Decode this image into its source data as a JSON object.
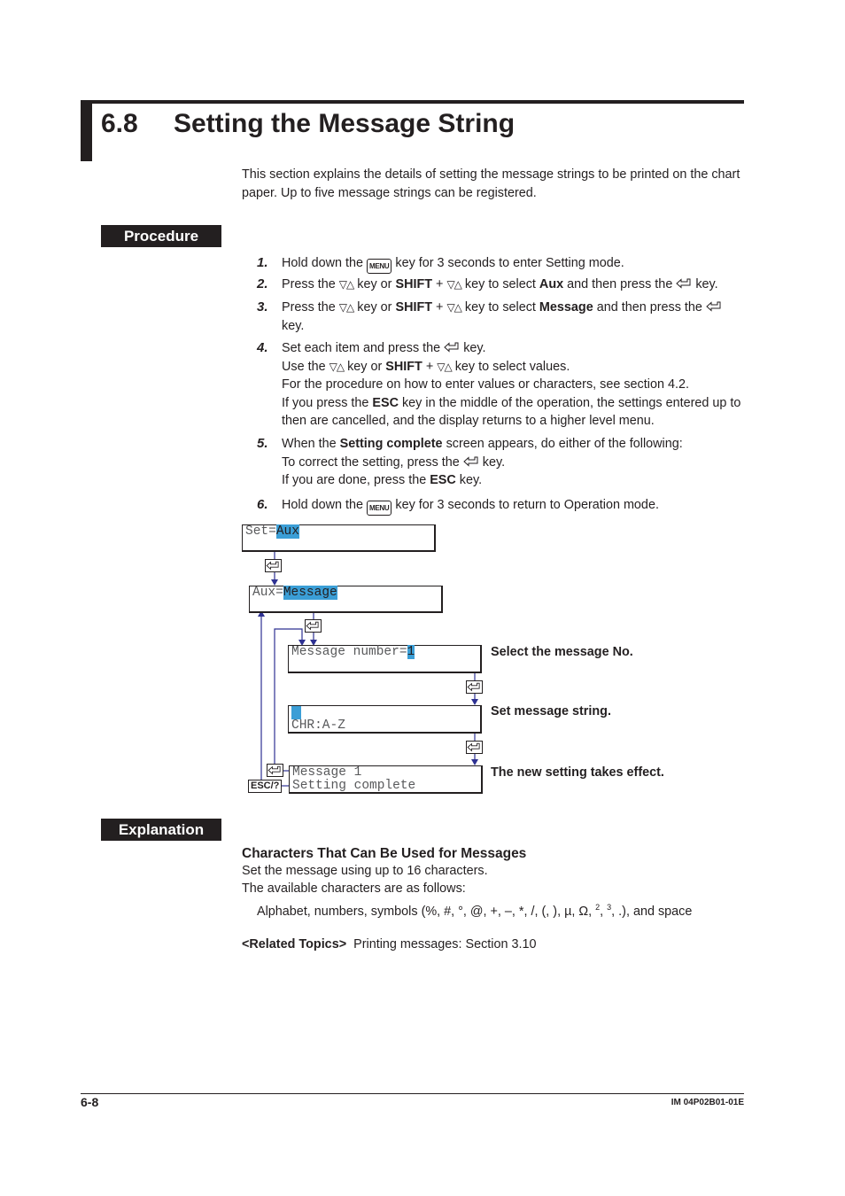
{
  "header": {
    "section_number": "6.8",
    "section_title": "Setting the Message String"
  },
  "intro": "This section explains the details of setting the message strings to be printed on the chart paper. Up to five message strings can be registered.",
  "procedure": {
    "label": "Procedure",
    "steps": [
      {
        "num": "1.",
        "lines": [
          [
            "Hold down the ",
            "[MENU]",
            " key for 3 seconds to enter Setting mode."
          ]
        ]
      },
      {
        "num": "2."
      },
      {
        "num": "3."
      },
      {
        "num": "4."
      },
      {
        "num": "5."
      },
      {
        "num": "6."
      }
    ],
    "text": {
      "hold_down": "Hold down the",
      "menu_key": "MENU",
      "step1_tail": "key for 3 seconds to enter Setting mode.",
      "press_the": "Press the",
      "updown": "▽△",
      "key_or": "key or",
      "shift": "SHIFT",
      "plus": "+",
      "key_to_select": "key to select",
      "aux": "Aux",
      "then_press": "and then press the",
      "key_dot": "key.",
      "message": "Message",
      "set_each": "Set each item and press the",
      "use_the": "Use the",
      "select_values": "key to select values.",
      "see_section": "For the procedure on how to enter values or characters, see section 4.2.",
      "if_press": "If you press the",
      "esc": "ESC",
      "esc_tail": "key in the middle of the operation, the settings entered up to",
      "cancelled": "then are cancelled, and the display returns to a higher level menu.",
      "when_the": "When the",
      "setting_complete": "Setting complete",
      "screen_appears": "screen appears, do either of the following:",
      "to_correct": "To correct the setting, press the",
      "if_done": "If you are done, press the",
      "step6_tail": "key for 3 seconds to return to Operation mode."
    }
  },
  "diagram": {
    "screen1": {
      "prefix": "Set=",
      "value": "Aux"
    },
    "screen2": {
      "prefix": "Aux=",
      "value": "Message"
    },
    "screen3": {
      "prefix": "Message number=",
      "value": "1",
      "note": "Select the message No."
    },
    "screen4": {
      "line2": "CHR:A-Z",
      "note": "Set message string."
    },
    "screen5": {
      "line1": "Message 1",
      "line2": "Setting complete",
      "note": "The new setting takes effect."
    },
    "esc_key": "ESC/?",
    "line_color": "#2e3192",
    "highlight_color": "#3b9ed6"
  },
  "explanation": {
    "label": "Explanation",
    "heading": "Characters That Can Be Used for Messages",
    "line1": "Set the message using up to 16 characters.",
    "line2": "The available characters are as follows:",
    "line3_a": "Alphabet, numbers, symbols (%, #, °, @, +, –, *, /, (, ), µ, Ω, ",
    "sup2": "2",
    "sep": ", ",
    "sup3": "3",
    "line3_b": ", .), and space",
    "related_label": "<Related Topics>",
    "related_text": "Printing messages: Section 3.10"
  },
  "footer": {
    "page": "6-8",
    "doc_id": "IM 04P02B01-01E"
  }
}
